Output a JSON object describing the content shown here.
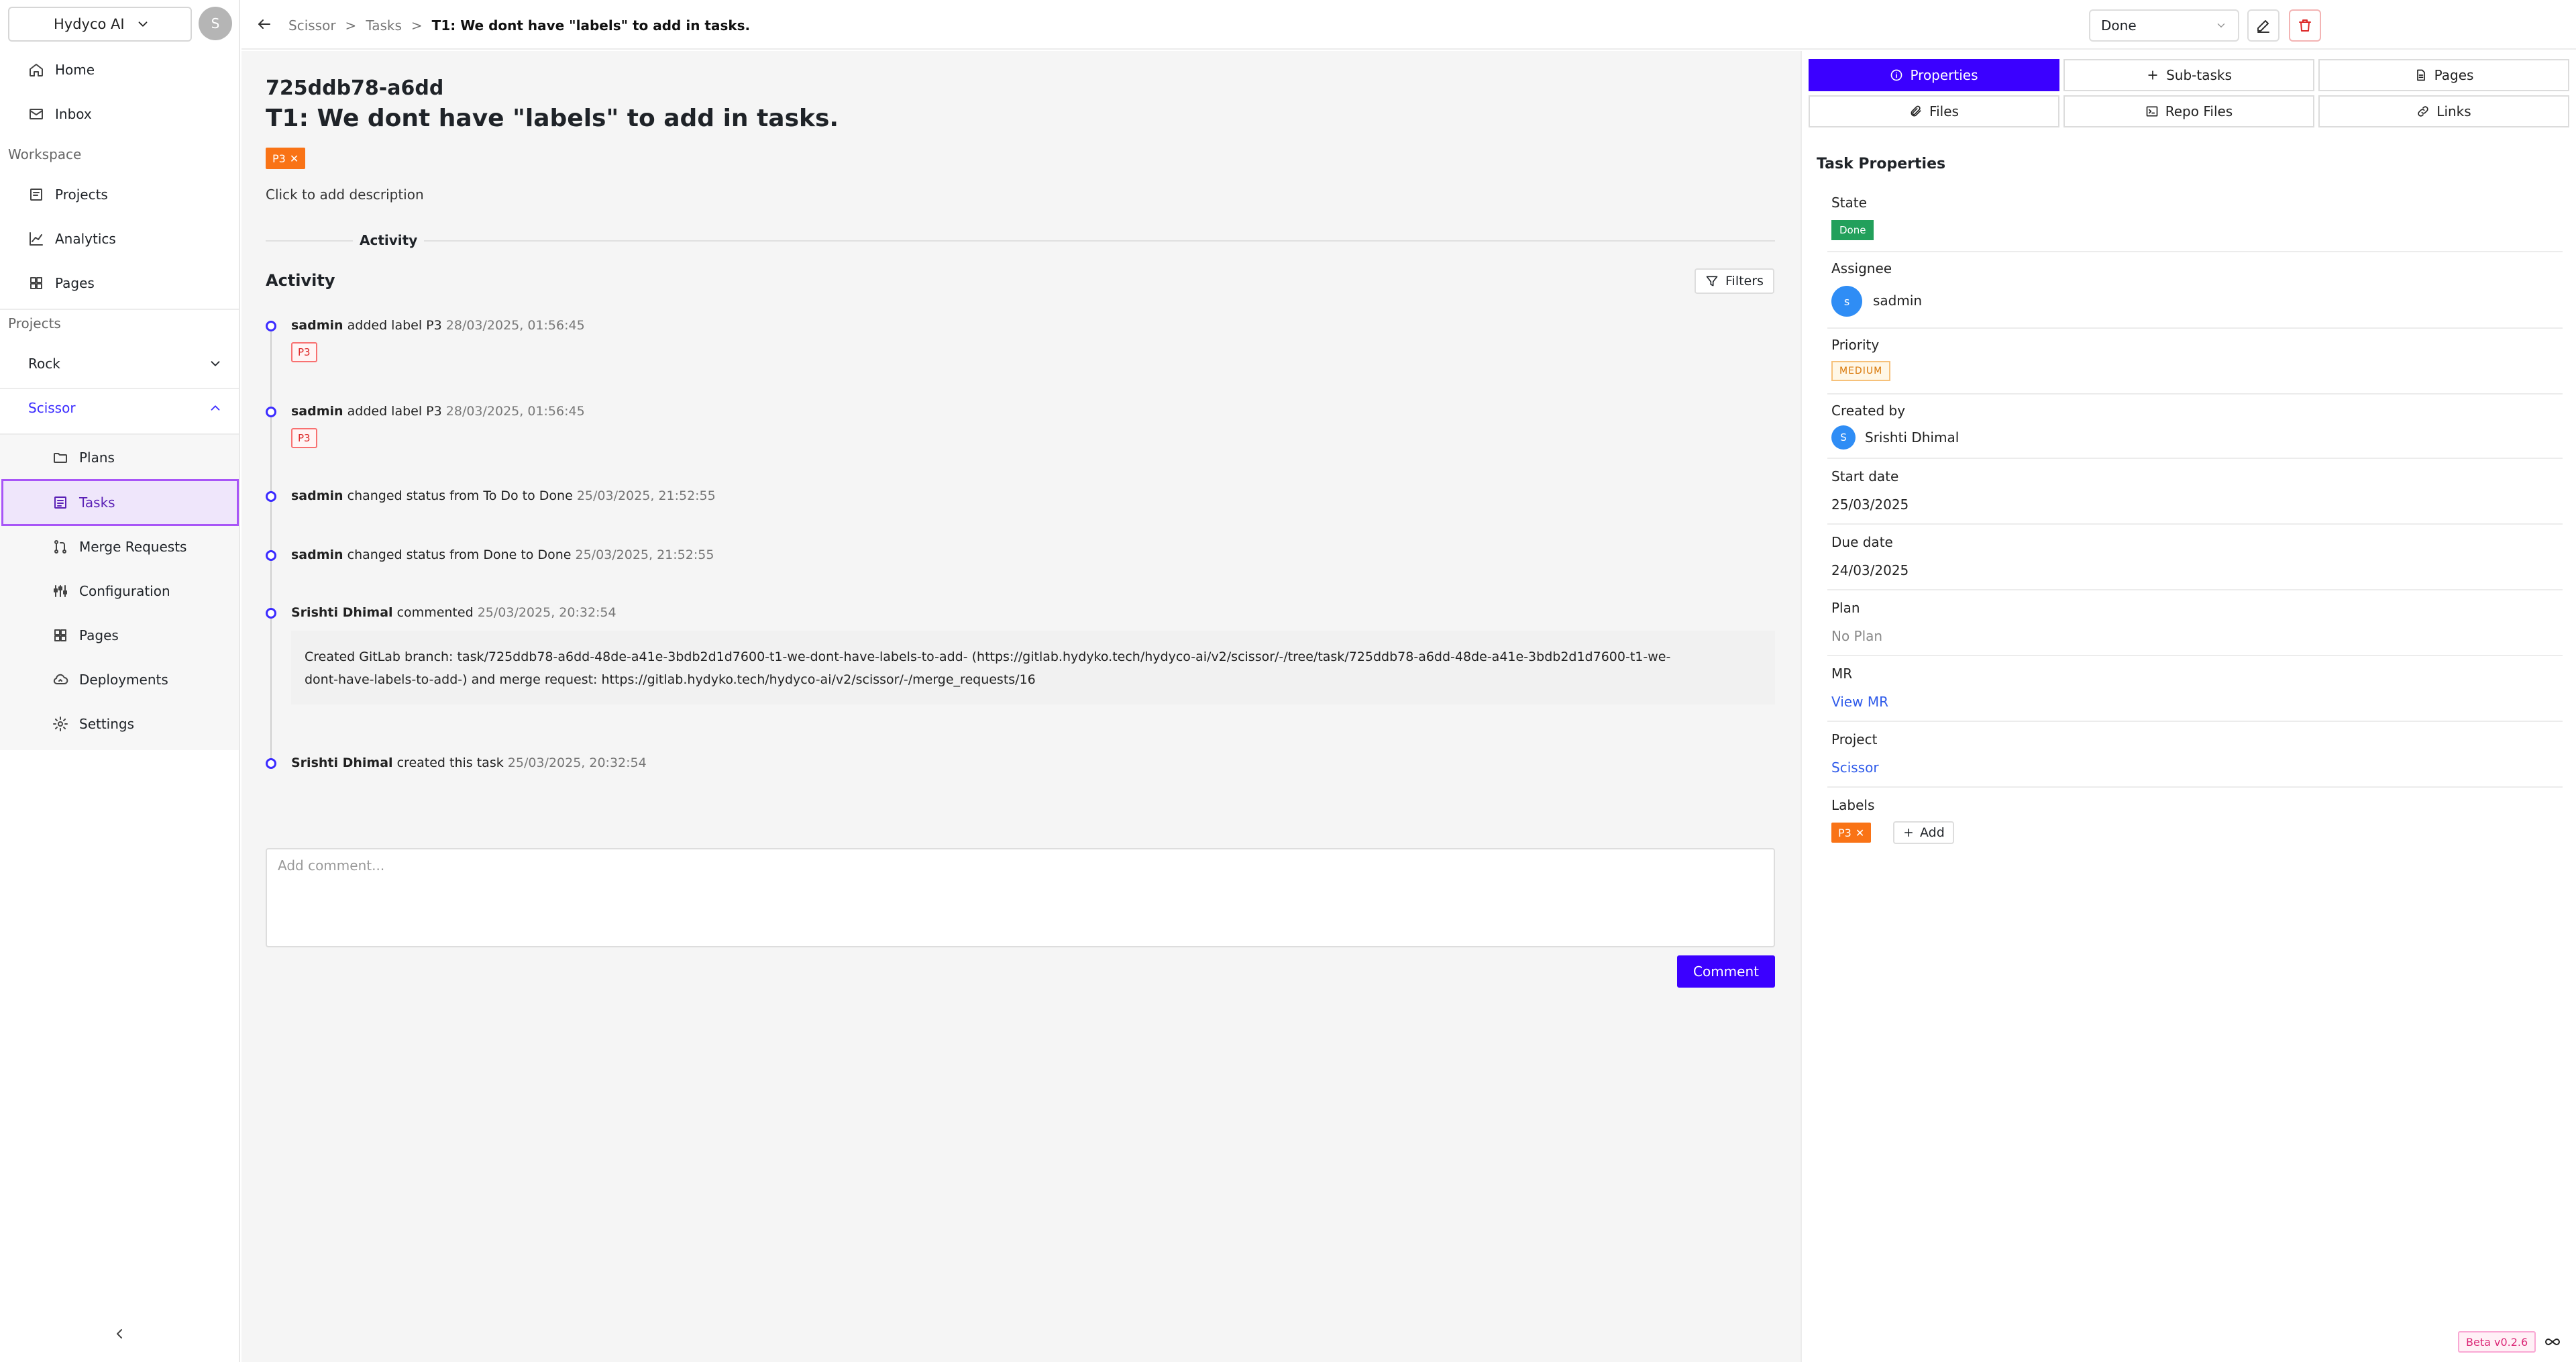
{
  "sidebar": {
    "org_name": "Hydyco AI",
    "user_initial": "S",
    "nav": [
      {
        "label": "Home",
        "icon": "home-icon"
      },
      {
        "label": "Inbox",
        "icon": "inbox-icon"
      }
    ],
    "workspace_label": "Workspace",
    "workspace_items": [
      {
        "label": "Projects",
        "icon": "projects-icon"
      },
      {
        "label": "Analytics",
        "icon": "analytics-icon"
      },
      {
        "label": "Pages",
        "icon": "pages-grid-icon"
      }
    ],
    "projects_label": "Projects",
    "projects": [
      {
        "label": "Rock",
        "expanded": false
      },
      {
        "label": "Scissor",
        "expanded": true
      }
    ],
    "project_items": [
      {
        "label": "Plans",
        "icon": "folder-icon"
      },
      {
        "label": "Tasks",
        "icon": "tasks-icon",
        "active": true
      },
      {
        "label": "Merge Requests",
        "icon": "merge-icon"
      },
      {
        "label": "Configuration",
        "icon": "config-icon"
      },
      {
        "label": "Pages",
        "icon": "pages-grid-icon"
      },
      {
        "label": "Deployments",
        "icon": "deploy-icon"
      },
      {
        "label": "Settings",
        "icon": "gear-icon"
      }
    ]
  },
  "topbar": {
    "breadcrumb": [
      "Scissor",
      "Tasks",
      "T1: We dont have \"labels\" to add in tasks."
    ],
    "separator": ">",
    "state_value": "Done"
  },
  "task": {
    "id": "725ddb78-a6dd",
    "title": "T1: We dont have \"labels\" to add in tasks.",
    "label": "P3",
    "description_placeholder": "Click to add description"
  },
  "activity": {
    "tab_label": "Activity",
    "heading": "Activity",
    "filters_label": "Filters",
    "events": [
      {
        "actor": "sadmin",
        "action": "added label P3",
        "time": "28/03/2025, 01:56:45",
        "tag": "P3"
      },
      {
        "actor": "sadmin",
        "action": "added label P3",
        "time": "28/03/2025, 01:56:45",
        "tag": "P3"
      },
      {
        "actor": "sadmin",
        "action": "changed status from To Do to Done",
        "time": "25/03/2025, 21:52:55"
      },
      {
        "actor": "sadmin",
        "action": "changed status from Done to Done",
        "time": "25/03/2025, 21:52:55"
      },
      {
        "actor": "Srishti Dhimal",
        "action": "commented",
        "time": "25/03/2025, 20:32:54"
      },
      {
        "actor": "Srishti Dhimal",
        "action": "created this task",
        "time": "25/03/2025, 20:32:54"
      }
    ],
    "comment_body_line1": "Created GitLab branch: task/725ddb78-a6dd-48de-a41e-3bdb2d1d7600-t1-we-dont-have-labels-to-add- (https://gitlab.hydyko.tech/hydyco-ai/v2/scissor/-/tree/task/725ddb78-a6dd-48de-a41e-3bdb2d1d7600-t1-we-",
    "comment_body_line2": "dont-have-labels-to-add-) and merge request: https://gitlab.hydyko.tech/hydyco-ai/v2/scissor/-/merge_requests/16"
  },
  "comment": {
    "placeholder": "Add comment...",
    "button_label": "Comment"
  },
  "right_panel": {
    "tabs": [
      {
        "label": "Properties",
        "icon": "info-icon",
        "active": true
      },
      {
        "label": "Sub-tasks",
        "icon": "plus-icon"
      },
      {
        "label": "Pages",
        "icon": "page-icon"
      },
      {
        "label": "Files",
        "icon": "paperclip-icon"
      },
      {
        "label": "Repo Files",
        "icon": "terminal-icon"
      },
      {
        "label": "Links",
        "icon": "link-icon"
      }
    ],
    "title": "Task Properties",
    "state_label": "State",
    "state_value": "Done",
    "assignee_label": "Assignee",
    "assignee_initial": "s",
    "assignee_name": "sadmin",
    "priority_label": "Priority",
    "priority_value": "MEDIUM",
    "created_by_label": "Created by",
    "created_by_initial": "S",
    "created_by_name": "Srishti Dhimal",
    "start_date_label": "Start date",
    "start_date_value": "25/03/2025",
    "due_date_label": "Due date",
    "due_date_value": "24/03/2025",
    "plan_label": "Plan",
    "plan_value": "No Plan",
    "mr_label": "MR",
    "mr_value": "View MR",
    "project_label": "Project",
    "project_value": "Scissor",
    "labels_label": "Labels",
    "labels_value": "P3",
    "add_label": "Add"
  },
  "footer": {
    "version": "Beta v0.2.6"
  },
  "colors": {
    "accent": "#3b00ff",
    "active_nav": "#a855f7",
    "label_orange": "#f97316",
    "done_green": "#22a05b"
  }
}
